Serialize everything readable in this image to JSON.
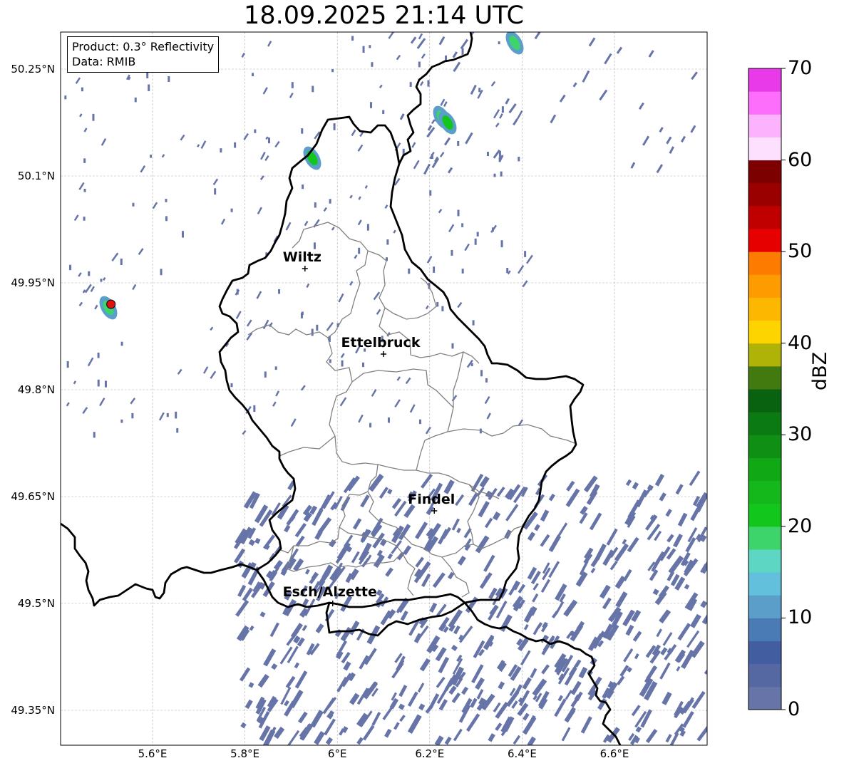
{
  "title": "18.09.2025 21:14 UTC",
  "info": {
    "product": "Product: 0.3° Reflectivity",
    "data": "Data: RMIB"
  },
  "axes": {
    "lon_ticks": [
      {
        "value": 5.6,
        "label": "5.6°E"
      },
      {
        "value": 5.8,
        "label": "5.8°E"
      },
      {
        "value": 6.0,
        "label": "6°E"
      },
      {
        "value": 6.2,
        "label": "6.2°E"
      },
      {
        "value": 6.4,
        "label": "6.4°E"
      },
      {
        "value": 6.6,
        "label": "6.6°E"
      }
    ],
    "lat_ticks": [
      {
        "value": 50.25,
        "label": "50.25°N"
      },
      {
        "value": 50.1,
        "label": "50.1°N"
      },
      {
        "value": 49.95,
        "label": "49.95°N"
      },
      {
        "value": 49.8,
        "label": "49.8°N"
      },
      {
        "value": 49.65,
        "label": "49.65°N"
      },
      {
        "value": 49.5,
        "label": "49.5°N"
      },
      {
        "value": 49.35,
        "label": "49.35°N"
      }
    ],
    "lon_range": [
      5.4,
      6.8
    ],
    "lat_range": [
      49.3,
      50.3
    ],
    "grid": true
  },
  "cities": [
    {
      "name": "Wiltz",
      "lon": 5.93,
      "lat": 49.97
    },
    {
      "name": "Ettelbruck",
      "lon": 6.1,
      "lat": 49.85
    },
    {
      "name": "Findel",
      "lon": 6.21,
      "lat": 49.63
    },
    {
      "name": "Esch/Alzette",
      "lon": 5.99,
      "lat": 49.5
    }
  ],
  "radar_site": {
    "lon": 5.51,
    "lat": 49.92,
    "color": "#e01010"
  },
  "colorbar": {
    "unit": "dBZ",
    "min": 0,
    "max": 70,
    "tick_labels": [
      "0",
      "10",
      "20",
      "30",
      "40",
      "50",
      "60",
      "70"
    ],
    "colors": [
      "#6674a8",
      "#5568a2",
      "#435ea0",
      "#4b7bb5",
      "#5a9ec9",
      "#62c0dd",
      "#5dd6c4",
      "#3dd46c",
      "#12c61c",
      "#14b81a",
      "#11a815",
      "#0f8f14",
      "#0b7a12",
      "#096210",
      "#437a0f",
      "#afb207",
      "#fdd400",
      "#fdb700",
      "#fd9b00",
      "#fd7c00",
      "#e70000",
      "#c00000",
      "#9b0000",
      "#7c0000",
      "#fde0fd",
      "#fdb2fd",
      "#fd6efd",
      "#e83ae8"
    ]
  },
  "legend_colors": {
    "border": "#000000",
    "admin": "#808080",
    "echo": "#6674a8",
    "grid": "#b0b0b0"
  }
}
